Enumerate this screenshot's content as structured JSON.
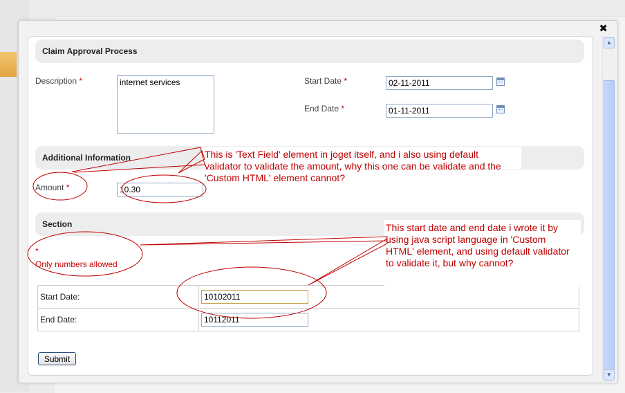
{
  "form": {
    "section1_title": "Claim Approval Process",
    "description_label": "Description",
    "description_value": "internet services",
    "start_date_label": "Start Date",
    "start_date_value": "02-11-2011",
    "end_date_label": "End Date",
    "end_date_value": "01-11-2011",
    "section2_title": "Additional Information",
    "amount_label": "Amount",
    "amount_value": "10.30",
    "section3_title": "Section",
    "required_mark": "*",
    "validation_star": "*",
    "validation_message": "Only numbers allowed",
    "custom_start_label": "Start Date:",
    "custom_start_value": "10102011",
    "custom_end_label": "End Date:",
    "custom_end_value": "10112011",
    "submit_label": "Submit"
  },
  "dialog": {
    "close_glyph": "✖"
  },
  "annotations": {
    "note1": "This is 'Text Field' element in joget itself, and i also using default validator to validate the amount, why this one can be validate and the 'Custom HTML' element cannot?",
    "note2": "This start date and end date i wrote it by using java script language in 'Custom HTML' element, and using default validator to validate it, but why cannot?",
    "color": "#c00000"
  },
  "icons": {
    "calendar": "calendar-icon",
    "close": "close-icon"
  }
}
